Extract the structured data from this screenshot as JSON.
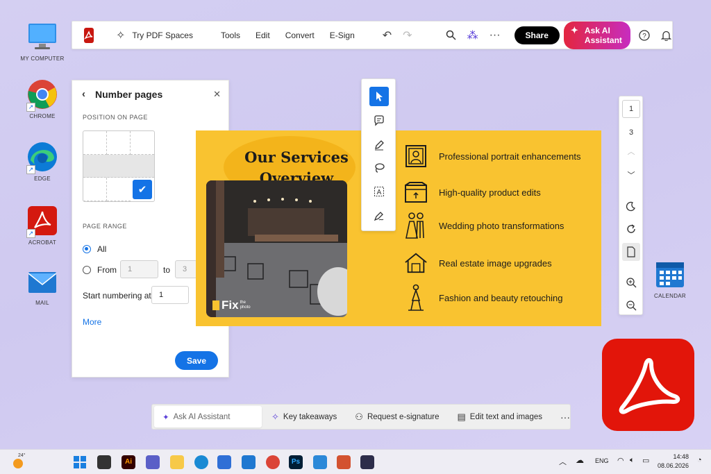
{
  "desktop": {
    "icons": [
      {
        "label": "MY COMPUTER"
      },
      {
        "label": "CHROME"
      },
      {
        "label": "EDGE"
      },
      {
        "label": "ACROBAT"
      },
      {
        "label": "MAIL"
      },
      {
        "label": "CALENDAR"
      }
    ]
  },
  "toolbar": {
    "try_spaces": "Try PDF Spaces",
    "menu": [
      "Tools",
      "Edit",
      "Convert",
      "E-Sign"
    ],
    "share": "Share",
    "ask_ai": "Ask AI Assistant"
  },
  "panel": {
    "title": "Number pages",
    "position_label": "POSITION ON PAGE",
    "range_label": "PAGE RANGE",
    "all_label": "All",
    "from_label": "From",
    "from_value": "1",
    "to_label": "to",
    "to_value": "3",
    "start_label": "Start numbering at",
    "start_value": "1",
    "more": "More",
    "save": "Save"
  },
  "document": {
    "title_line1": "Our Services",
    "title_line2": "Overview",
    "logo_main": "Fix",
    "logo_sub": "the photo",
    "services": [
      "Professional portrait enhancements",
      "High-quality product edits",
      "Wedding photo transformations",
      "Real estate image upgrades",
      "Fashion and beauty retouching"
    ]
  },
  "page_nav": {
    "current": "1",
    "total": "3"
  },
  "quickbar": {
    "ask": "Ask AI Assistant",
    "items": [
      "Key takeaways",
      "Request e-signature",
      "Edit text and images"
    ],
    "more": "···"
  },
  "taskbar": {
    "weather": "24°",
    "lang": "ENG",
    "time": "14:48",
    "date": "08.06.2026"
  },
  "colors": {
    "accent": "#1473e6",
    "acrobat_red": "#e2150a",
    "doc_yellow": "#f9c330"
  }
}
